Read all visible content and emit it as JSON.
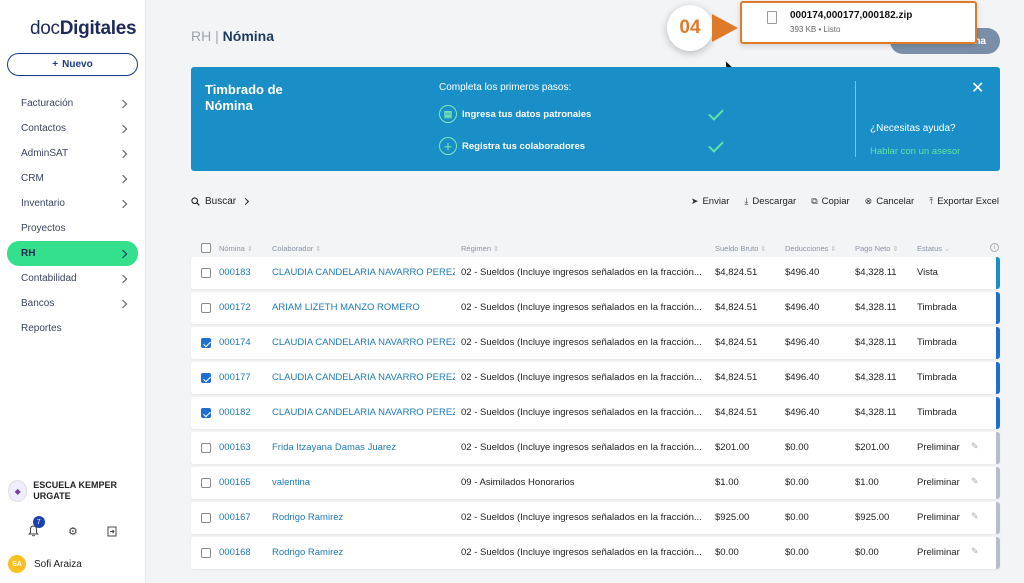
{
  "logo": {
    "prefix": "doc",
    "suffix": "Digitales"
  },
  "sidebar": {
    "new_label": "Nuevo",
    "items": [
      {
        "label": "Facturación",
        "chevron": true,
        "active": false
      },
      {
        "label": "Contactos",
        "chevron": true,
        "active": false
      },
      {
        "label": "AdminSAT",
        "chevron": true,
        "active": false
      },
      {
        "label": "CRM",
        "chevron": true,
        "active": false
      },
      {
        "label": "Inventario",
        "chevron": true,
        "active": false
      },
      {
        "label": "Proyectos",
        "chevron": false,
        "active": false
      },
      {
        "label": "RH",
        "chevron": true,
        "active": true
      },
      {
        "label": "Contabilidad",
        "chevron": true,
        "active": false
      },
      {
        "label": "Bancos",
        "chevron": true,
        "active": false
      },
      {
        "label": "Reportes",
        "chevron": false,
        "active": false
      }
    ],
    "company_name": "ESCUELA KEMPER URGATE",
    "notification_count": "7",
    "user_initials": "SA",
    "user_name": "Sofi Araiza"
  },
  "header": {
    "section": "RH",
    "separator": "|",
    "page": "Nómina",
    "button_label": "ina"
  },
  "download": {
    "filename": "000174,000177,000182.zip",
    "meta": "393 KB • Listo"
  },
  "step_badge": "04",
  "banner": {
    "title": "Timbrado de Nómina",
    "subtitle": "Completa los primeros pasos:",
    "step1": "Ingresa tus datos patronales",
    "step2": "Registra tus colaboradores",
    "help_question": "¿Necesitas ayuda?",
    "help_link": "Hablar con un asesor"
  },
  "toolbar": {
    "search_label": "Buscar",
    "actions": [
      "Enviar",
      "Descargar",
      "Copiar",
      "Cancelar",
      "Exportar Excel"
    ]
  },
  "table": {
    "headers": [
      "Nómina",
      "Colaborador",
      "Régimen",
      "Sueldo Bruto",
      "Deducciones",
      "Pago Neto",
      "Estatus"
    ],
    "rows": [
      {
        "nomina": "000183",
        "colaborador": "CLAUDIA CANDELARIA NAVARRO PEREZ",
        "regimen": "02 - Sueldos (Incluye ingresos señalados en la fracción...",
        "bruto": "$4,824.51",
        "deducciones": "$496.40",
        "neto": "$4,328.11",
        "estatus": "Vista",
        "checked": false,
        "stripe": "#1a8fc7",
        "editable": false
      },
      {
        "nomina": "000172",
        "colaborador": "ARIAM LIZETH MANZO ROMERO",
        "regimen": "02 - Sueldos (Incluye ingresos señalados en la fracción...",
        "bruto": "$4,824.51",
        "deducciones": "$496.40",
        "neto": "$4,328.11",
        "estatus": "Timbrada",
        "checked": false,
        "stripe": "#1f6fd1",
        "editable": false
      },
      {
        "nomina": "000174",
        "colaborador": "CLAUDIA CANDELARIA NAVARRO PEREZ",
        "regimen": "02 - Sueldos (Incluye ingresos señalados en la fracción...",
        "bruto": "$4,824.51",
        "deducciones": "$496.40",
        "neto": "$4,328.11",
        "estatus": "Timbrada",
        "checked": true,
        "stripe": "#1f6fd1",
        "editable": false
      },
      {
        "nomina": "000177",
        "colaborador": "CLAUDIA CANDELARIA NAVARRO PEREZ",
        "regimen": "02 - Sueldos (Incluye ingresos señalados en la fracción...",
        "bruto": "$4,824.51",
        "deducciones": "$496.40",
        "neto": "$4,328.11",
        "estatus": "Timbrada",
        "checked": true,
        "stripe": "#1f6fd1",
        "editable": false
      },
      {
        "nomina": "000182",
        "colaborador": "CLAUDIA CANDELARIA NAVARRO PEREZ",
        "regimen": "02 - Sueldos (Incluye ingresos señalados en la fracción...",
        "bruto": "$4,824.51",
        "deducciones": "$496.40",
        "neto": "$4,328.11",
        "estatus": "Timbrada",
        "checked": true,
        "stripe": "#1f6fd1",
        "editable": false
      },
      {
        "nomina": "000163",
        "colaborador": "Frida Itzayana Damas Juarez",
        "regimen": "02 - Sueldos (Incluye ingresos señalados en la fracción...",
        "bruto": "$201.00",
        "deducciones": "$0.00",
        "neto": "$201.00",
        "estatus": "Preliminar",
        "checked": false,
        "stripe": "#b8bec8",
        "editable": true
      },
      {
        "nomina": "000165",
        "colaborador": "valentina",
        "regimen": "09 - Asimilados Honorarios",
        "bruto": "$1.00",
        "deducciones": "$0.00",
        "neto": "$1.00",
        "estatus": "Preliminar",
        "checked": false,
        "stripe": "#b8bec8",
        "editable": true
      },
      {
        "nomina": "000167",
        "colaborador": "Rodrigo Ramirez",
        "regimen": "02 - Sueldos (Incluye ingresos señalados en la fracción...",
        "bruto": "$925.00",
        "deducciones": "$0.00",
        "neto": "$925.00",
        "estatus": "Preliminar",
        "checked": false,
        "stripe": "#b8bec8",
        "editable": true
      },
      {
        "nomina": "000168",
        "colaborador": "Rodrigo Ramirez",
        "regimen": "02 - Sueldos (Incluye ingresos señalados en la fracción...",
        "bruto": "$0.00",
        "deducciones": "$0.00",
        "neto": "$0.00",
        "estatus": "Preliminar",
        "checked": false,
        "stripe": "#b8bec8",
        "editable": true
      }
    ]
  }
}
